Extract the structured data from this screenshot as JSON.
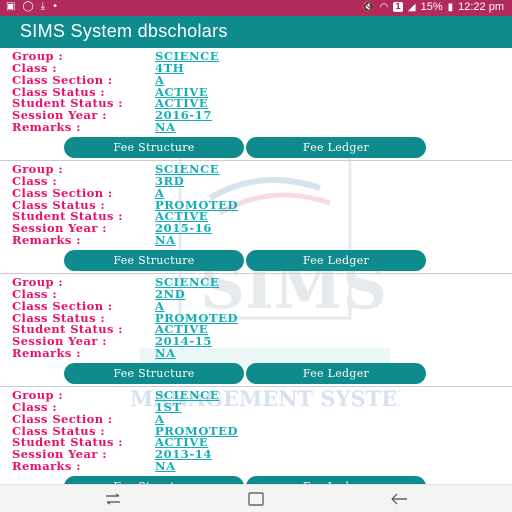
{
  "status_bar": {
    "notification_count": "1",
    "battery": "15%",
    "time": "12:22 pm"
  },
  "app_bar": {
    "title": "SIMS System dbscholars"
  },
  "labels": {
    "group": "Group :",
    "class": "Class :",
    "class_section": "Class Section :",
    "class_status": "Class Status :",
    "student_status": "Student Status :",
    "session_year": "Session Year :",
    "remarks": "Remarks :"
  },
  "buttons": {
    "fee_structure": "Fee Structure",
    "fee_ledger": "Fee Ledger"
  },
  "records": [
    {
      "group": "SCIENCE",
      "class": "4TH",
      "class_section": "A",
      "class_status": "ACTIVE",
      "student_status": "ACTIVE",
      "session_year": "2016-17",
      "remarks": "NA"
    },
    {
      "group": "SCIENCE",
      "class": "3RD",
      "class_section": "A",
      "class_status": "PROMOTED",
      "student_status": "ACTIVE",
      "session_year": "2015-16",
      "remarks": "NA"
    },
    {
      "group": "SCIENCE",
      "class": "2ND",
      "class_section": "A",
      "class_status": "PROMOTED",
      "student_status": "ACTIVE",
      "session_year": "2014-15",
      "remarks": "NA"
    },
    {
      "group": "SCIENCE",
      "class": "1ST",
      "class_section": "A",
      "class_status": "PROMOTED",
      "student_status": "ACTIVE",
      "session_year": "2013-14",
      "remarks": "NA"
    }
  ],
  "colors": {
    "status_bar": "#b02b5c",
    "app_bar": "#0f8b8d",
    "label": "#e8106c",
    "value": "#11aeb6",
    "button": "#0f8b8d"
  },
  "watermark": {
    "text_main": "SIMS",
    "text_sub": "MANAGEMENT SYSTEM"
  }
}
